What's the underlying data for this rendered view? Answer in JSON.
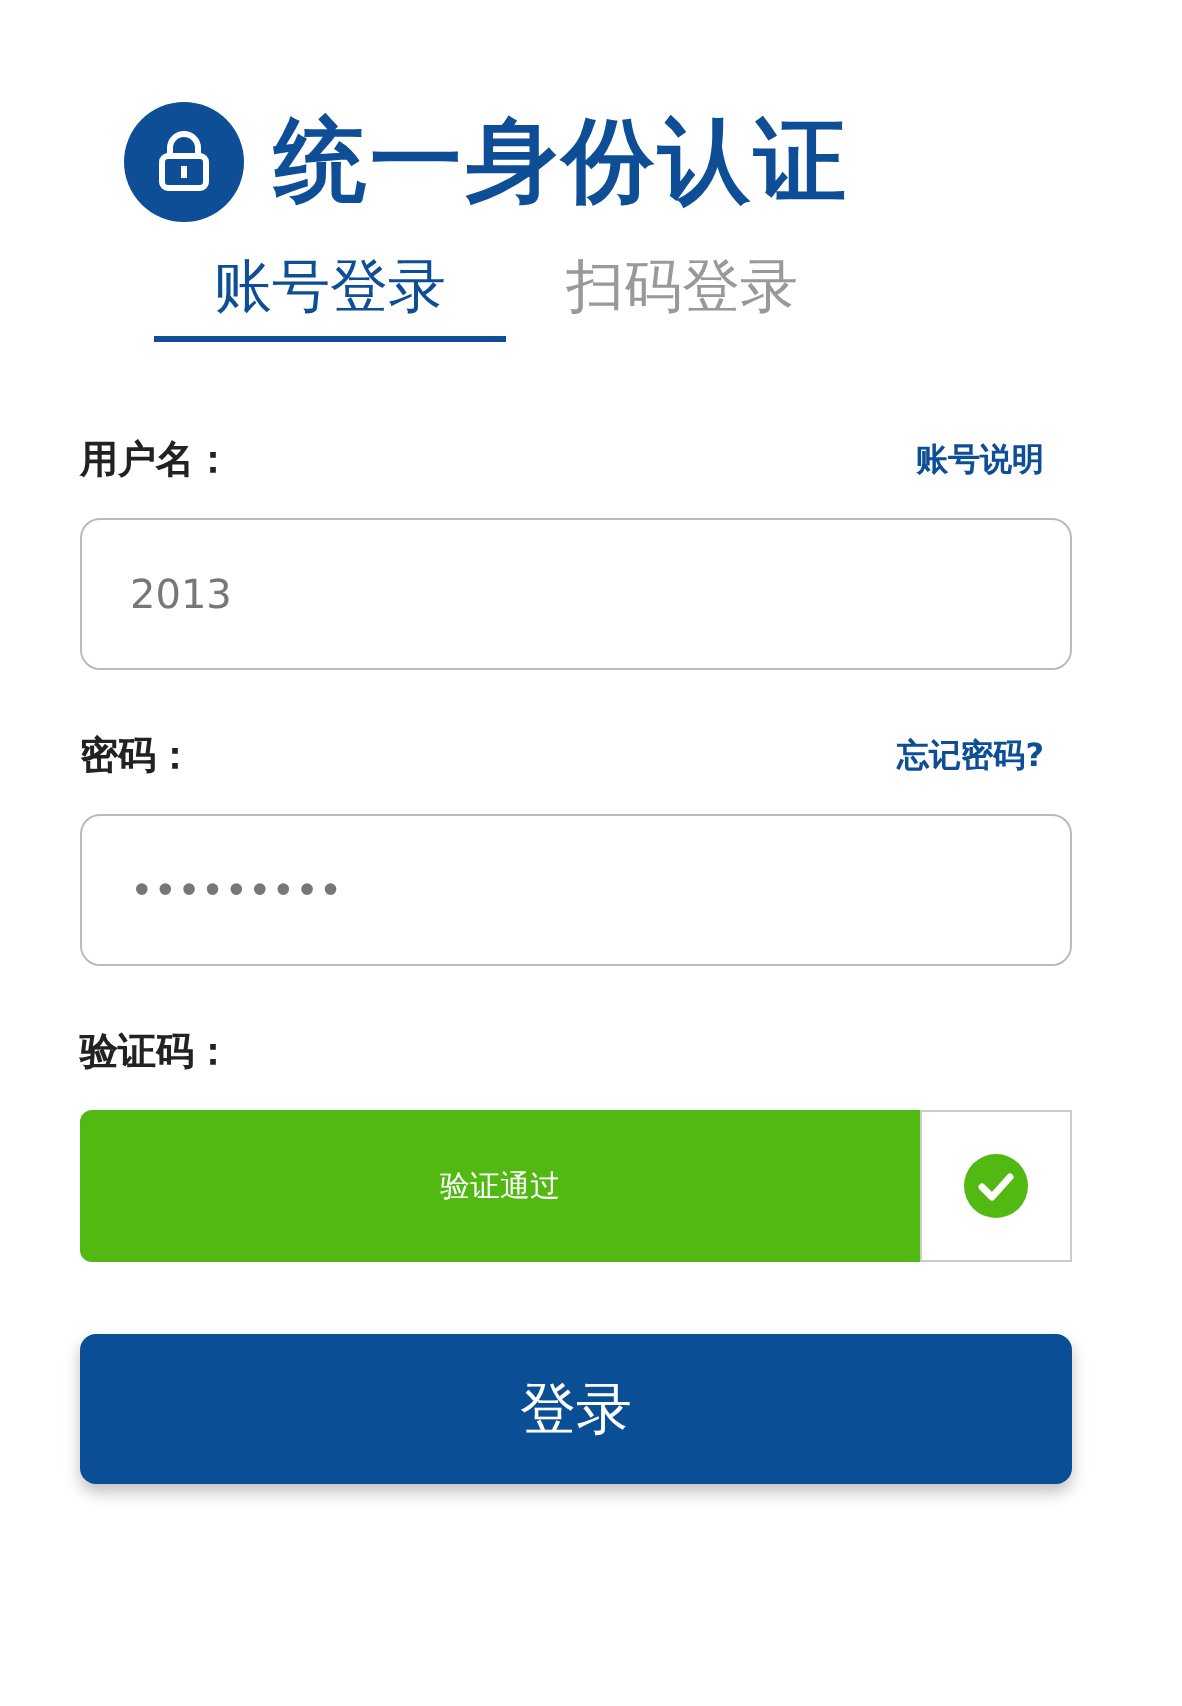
{
  "header": {
    "title": "统一身份认证"
  },
  "tabs": [
    {
      "label": "账号登录",
      "selected": true
    },
    {
      "label": "扫码登录",
      "selected": false
    }
  ],
  "fields": [
    {
      "label": "用户名：",
      "link": "账号说明",
      "value": "2013"
    },
    {
      "label": "密码：",
      "link": "忘记密码?",
      "value": "•••••••••"
    }
  ],
  "captcha": {
    "label": "验证码：",
    "verified": true,
    "text": "验证通过"
  },
  "login_button": "登录"
}
